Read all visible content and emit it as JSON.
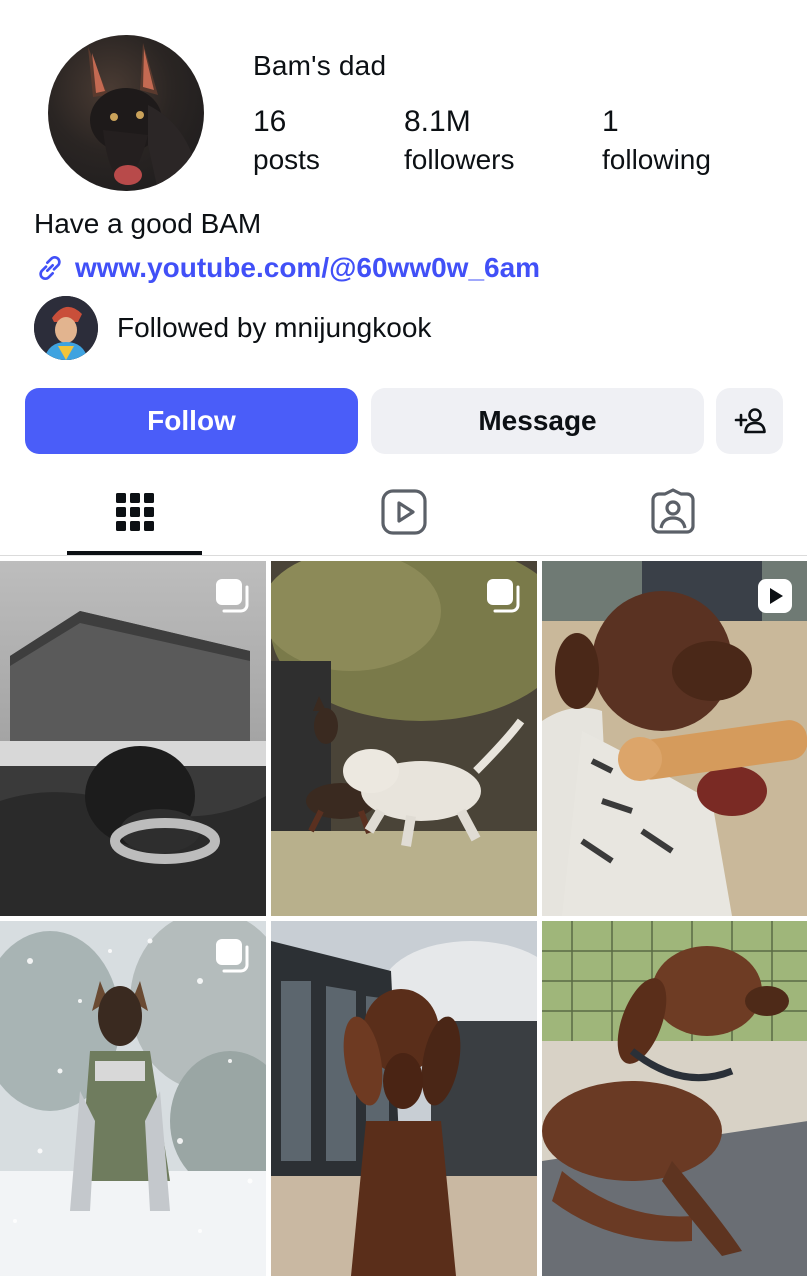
{
  "profile": {
    "display_name": "Bam's dad",
    "avatar_icon": "dog-avatar",
    "stats": {
      "posts": {
        "value": "16",
        "label": "posts"
      },
      "followers": {
        "value": "8.1M",
        "label": "followers"
      },
      "following": {
        "value": "1",
        "label": "following"
      }
    },
    "bio": "Have a good BAM",
    "link": {
      "icon": "link-icon",
      "text": "www.youtube.com/@60ww0w_6am"
    },
    "followed_by": "Followed by mnijungkook"
  },
  "actions": {
    "follow_label": "Follow",
    "message_label": "Message",
    "add_user_icon": "add-user-icon"
  },
  "tabs": [
    {
      "name": "posts-grid",
      "icon": "grid-icon",
      "active": true
    },
    {
      "name": "reels",
      "icon": "reels-icon",
      "active": false
    },
    {
      "name": "tagged",
      "icon": "tagged-icon",
      "active": false
    }
  ],
  "posts": [
    {
      "name": "post-1",
      "badge": "carousel-icon"
    },
    {
      "name": "post-2",
      "badge": "carousel-icon"
    },
    {
      "name": "post-3",
      "badge": "video-icon"
    },
    {
      "name": "post-4",
      "badge": "carousel-icon"
    },
    {
      "name": "post-5",
      "badge": ""
    },
    {
      "name": "post-6",
      "badge": ""
    }
  ],
  "colors": {
    "accent": "#4a5df9",
    "link": "#4150f7",
    "secondary_button": "#eff0f4",
    "text": "#0c1014"
  }
}
